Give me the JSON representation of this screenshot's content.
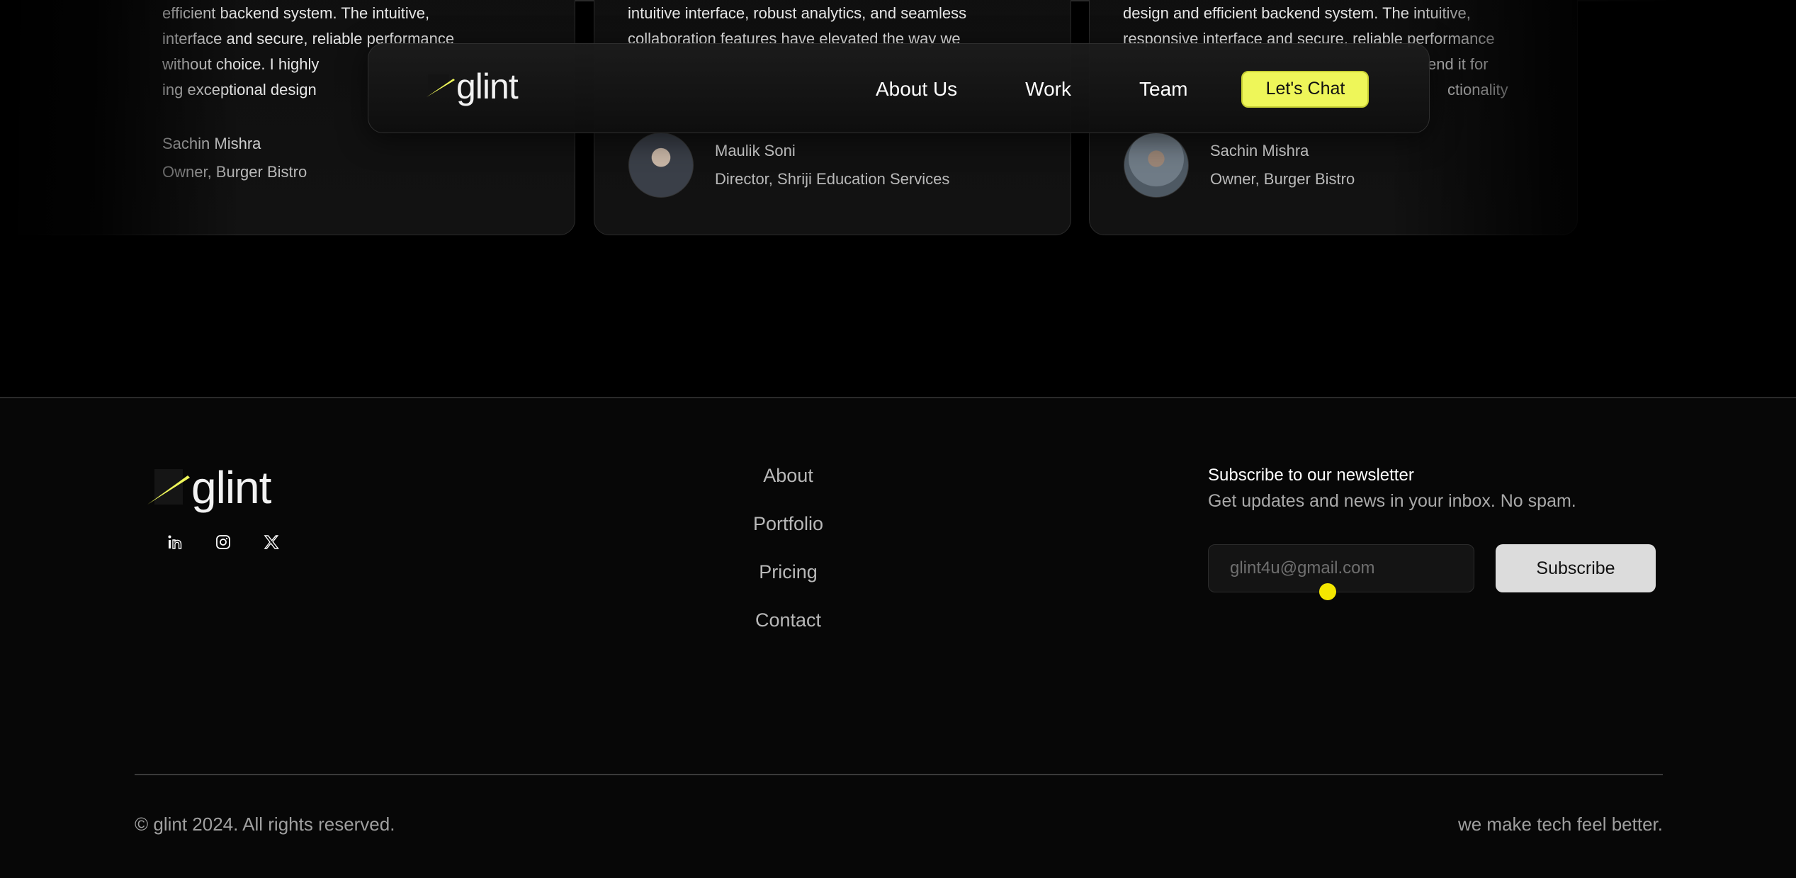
{
  "testimonials": [
    {
      "quote_lines": [
        "efficient backend system. The intuitive,",
        "interface and secure, reliable performance",
        "without choice. I highly",
        "ing exceptional design"
      ],
      "name": "Sachin Mishra",
      "role": "Owner, Burger Bistro"
    },
    {
      "quote_lines": [
        "intuitive interface, robust analytics, and seamless",
        "collaboration features have elevated the way we"
      ],
      "name": "Maulik Soni",
      "role": "Director, Shriji Education Services"
    },
    {
      "quote_lines": [
        "design and efficient backend system. The intuitive,",
        "responsive interface and secure, reliable performance",
        "end it for",
        "ctionality"
      ],
      "name": "Sachin Mishra",
      "role": "Owner, Burger Bistro"
    }
  ],
  "navbar": {
    "logo_text": "glint",
    "links": [
      "About Us",
      "Work",
      "Team"
    ],
    "cta_label": "Let's Chat"
  },
  "footer": {
    "logo_text": "glint",
    "social_icons": [
      "linkedin-icon",
      "instagram-icon",
      "x-icon"
    ],
    "links": [
      "About",
      "Portfolio",
      "Pricing",
      "Contact"
    ],
    "newsletter": {
      "title": "Subscribe to our newsletter",
      "subtitle": "Get updates and news in your inbox. No spam.",
      "email_placeholder": "glint4u@gmail.com",
      "button_label": "Subscribe"
    },
    "copyright": "© glint 2024. All rights reserved.",
    "tagline": "we make tech feel better."
  },
  "colors": {
    "accent": "#eef659",
    "background": "#000000",
    "footer_background": "#070707"
  }
}
